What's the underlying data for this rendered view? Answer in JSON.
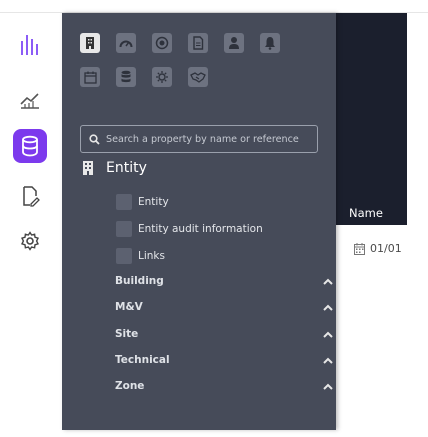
{
  "rail": {
    "items": [
      {
        "icon": "bars-chart-icon"
      },
      {
        "icon": "trend-chart-icon"
      },
      {
        "icon": "database-icon",
        "active": true
      },
      {
        "icon": "document-edit-icon"
      },
      {
        "icon": "gear-icon"
      }
    ],
    "accent": "#7c3aed"
  },
  "toolbar": {
    "row1": [
      "building-icon",
      "speedometer-icon",
      "target-icon",
      "file-icon",
      "user-icon",
      "bell-icon"
    ],
    "row2": [
      "calendar-icon",
      "database-icon",
      "sun-icon",
      "handshake-icon"
    ]
  },
  "search": {
    "placeholder": "Search a property by name or reference"
  },
  "entity": {
    "title": "Entity",
    "options": [
      {
        "label": "Entity"
      },
      {
        "label": "Entity audit information"
      },
      {
        "label": "Links"
      }
    ]
  },
  "groups": [
    {
      "label": "Building"
    },
    {
      "label": "M&V"
    },
    {
      "label": "Site"
    },
    {
      "label": "Technical"
    },
    {
      "label": "Zone"
    }
  ],
  "table": {
    "column_name": "Name",
    "first_date": "01/01"
  },
  "colors": {
    "panel": "#464b59",
    "header": "#1b1f2d"
  }
}
